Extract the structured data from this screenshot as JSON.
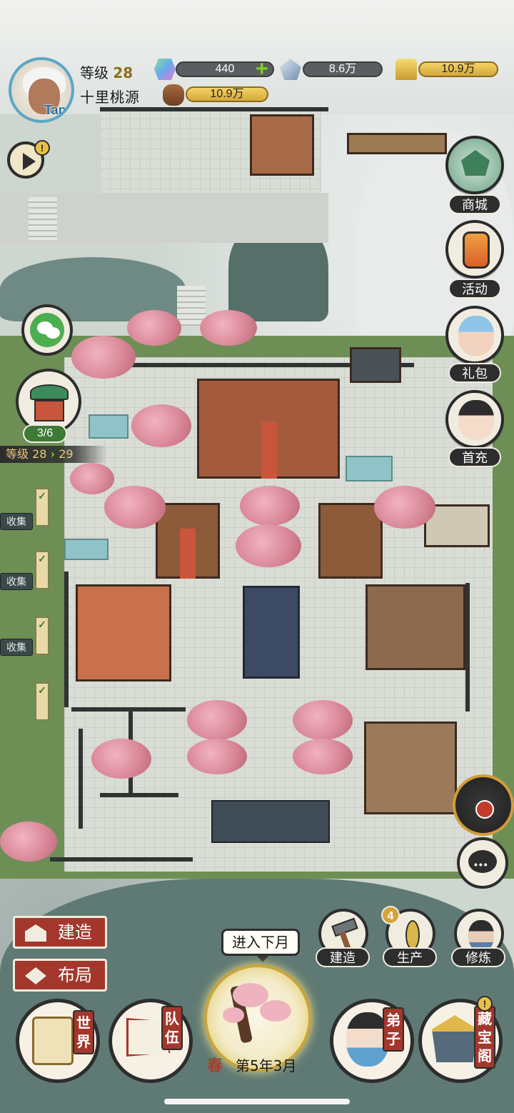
{
  "player": {
    "level_label": "等级",
    "level": "28",
    "sect_name": "十里桃源",
    "avatar_tag": "Tap"
  },
  "resources": {
    "jade": "440",
    "crystal": "8.6万",
    "gold": "10.9万",
    "wood": "10.9万"
  },
  "right_menu": {
    "shop": "商城",
    "event": "活动",
    "gift": "礼包",
    "first_charge": "首充"
  },
  "left_panel": {
    "task_progress": "3/6",
    "level_from": "等级 28",
    "level_to": "29",
    "collect_label": "收集",
    "collect_check": "✓"
  },
  "bottom_left": {
    "build": "建造",
    "layout": "布局"
  },
  "tools": {
    "build": "建造",
    "produce": "生产",
    "produce_badge": "4",
    "cultivate": "修炼"
  },
  "nav": {
    "world": "世界",
    "team": "队伍",
    "disciples": "弟子",
    "treasure": "藏宝阁",
    "next_month": "进入下月",
    "season": "春",
    "date": "第5年3月"
  },
  "colors": {
    "accent_red": "#a3372c",
    "gold": "#d3a93a",
    "dark": "#2d2d2d",
    "parchment": "#f1ece0"
  }
}
